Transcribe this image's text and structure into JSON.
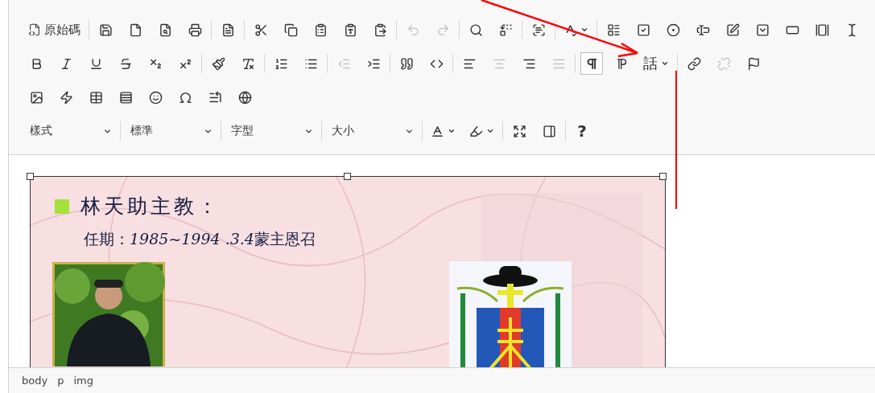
{
  "toolbar": {
    "rows": [
      [
        [
          {
            "kind": "labeled",
            "label": "原始碼",
            "disabled": false,
            "on": false
          }
        ],
        [
          {
            "kind": "icon",
            "disabled": false,
            "on": false
          },
          {
            "kind": "icon",
            "disabled": false,
            "on": false
          },
          {
            "kind": "icon",
            "disabled": false,
            "on": false
          },
          {
            "kind": "icon",
            "disabled": false,
            "on": false
          }
        ],
        [
          {
            "kind": "icon",
            "disabled": false,
            "on": false
          }
        ],
        [
          {
            "kind": "icon",
            "disabled": false,
            "on": false
          },
          {
            "kind": "icon",
            "disabled": false,
            "on": false
          },
          {
            "kind": "icon",
            "disabled": false,
            "on": false
          },
          {
            "kind": "icon",
            "disabled": false,
            "on": false
          },
          {
            "kind": "icon",
            "disabled": false,
            "on": false
          }
        ],
        [
          {
            "kind": "icon",
            "disabled": true,
            "on": false
          },
          {
            "kind": "icon",
            "disabled": true,
            "on": false
          }
        ],
        [
          {
            "kind": "icon",
            "disabled": false,
            "on": false
          },
          {
            "kind": "icon",
            "disabled": false,
            "on": false
          }
        ],
        [
          {
            "kind": "icon",
            "disabled": false,
            "on": false
          }
        ],
        [
          {
            "kind": "menu",
            "disabled": false,
            "on": false
          }
        ],
        [
          {
            "kind": "icon"
          },
          {
            "kind": "icon"
          },
          {
            "kind": "icon"
          },
          {
            "kind": "icon"
          },
          {
            "kind": "icon"
          },
          {
            "kind": "icon"
          },
          {
            "kind": "icon"
          },
          {
            "kind": "icon"
          },
          {
            "kind": "icon"
          }
        ]
      ],
      [
        [
          {
            "kind": "icon",
            "disabled": false,
            "on": false
          },
          {
            "kind": "icon",
            "disabled": false,
            "on": false
          },
          {
            "kind": "icon",
            "disabled": false,
            "on": false
          },
          {
            "kind": "icon",
            "disabled": false,
            "on": false
          },
          {
            "kind": "icon",
            "disabled": false,
            "on": false
          },
          {
            "kind": "icon",
            "disabled": false,
            "on": false
          }
        ],
        [
          {
            "kind": "icon",
            "disabled": false,
            "on": false
          },
          {
            "kind": "icon",
            "disabled": false,
            "on": false
          }
        ],
        [
          {
            "kind": "icon",
            "disabled": false,
            "on": false
          },
          {
            "kind": "icon",
            "disabled": false,
            "on": false
          }
        ],
        [
          {
            "kind": "icon",
            "disabled": true,
            "on": false
          },
          {
            "kind": "icon",
            "disabled": false,
            "on": false
          }
        ],
        [
          {
            "kind": "icon",
            "disabled": false,
            "on": false
          },
          {
            "kind": "icon",
            "disabled": false,
            "on": false
          }
        ],
        [
          {
            "kind": "icon",
            "disabled": false,
            "on": false
          },
          {
            "kind": "icon",
            "disabled": true,
            "on": false
          },
          {
            "kind": "icon",
            "disabled": false,
            "on": false
          },
          {
            "kind": "icon",
            "disabled": true,
            "on": false
          }
        ],
        [
          {
            "kind": "icon",
            "disabled": false,
            "on": true
          },
          {
            "kind": "icon",
            "disabled": false,
            "on": false
          },
          {
            "kind": "text-menu",
            "label": "話",
            "disabled": false,
            "on": false
          }
        ],
        [
          {
            "kind": "icon",
            "disabled": false,
            "on": false
          },
          {
            "kind": "icon",
            "disabled": true,
            "on": false
          },
          {
            "kind": "icon",
            "disabled": false,
            "on": false
          }
        ]
      ],
      [
        [
          {
            "kind": "icon",
            "disabled": false,
            "on": false
          },
          {
            "kind": "icon",
            "disabled": false,
            "on": false
          },
          {
            "kind": "icon",
            "disabled": false,
            "on": false
          },
          {
            "kind": "icon",
            "disabled": false,
            "on": false
          },
          {
            "kind": "icon",
            "disabled": false,
            "on": false
          },
          {
            "kind": "icon",
            "disabled": false,
            "on": false
          },
          {
            "kind": "icon",
            "disabled": false,
            "on": false
          },
          {
            "kind": "icon",
            "disabled": false,
            "on": false
          }
        ]
      ],
      [
        [
          {
            "kind": "combo",
            "label": "樣式"
          }
        ],
        [
          {
            "kind": "combo",
            "label": "標準"
          }
        ],
        [
          {
            "kind": "combo",
            "label": "字型"
          }
        ],
        [
          {
            "kind": "combo",
            "label": "大小"
          }
        ],
        [
          {
            "kind": "menu",
            "disabled": false,
            "on": false
          },
          {
            "kind": "menu",
            "disabled": false,
            "on": false
          }
        ],
        [
          {
            "kind": "icon",
            "disabled": false,
            "on": false
          },
          {
            "kind": "icon",
            "disabled": false,
            "on": false
          }
        ],
        [
          {
            "kind": "text",
            "label": "?",
            "disabled": false,
            "on": false
          }
        ]
      ]
    ]
  },
  "editor": {
    "image": {
      "kind": "picture",
      "heading": "林天助主教：",
      "term": {
        "label": "任期：",
        "dates": "1985~1994  .3.4",
        "note": "蒙主恩召"
      },
      "selected": true
    }
  },
  "status_bar": {
    "path": [
      "body",
      "p",
      "img"
    ]
  }
}
